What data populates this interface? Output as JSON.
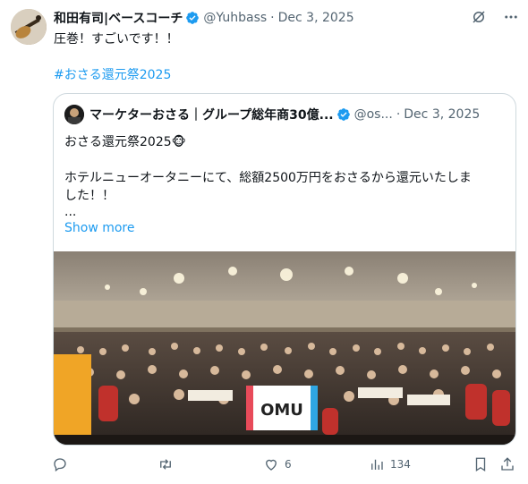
{
  "author": {
    "display_name": "和田有司|ベースコーチ",
    "handle": "@Yuhbass",
    "separator": "·",
    "date": "Dec 3, 2025"
  },
  "post": {
    "text": "圧巻！すごいです！！",
    "hashtag": "#おさる還元祭2025"
  },
  "quoted": {
    "display_name": "マーケターおさる｜グループ総年商30億...",
    "handle": "@os...",
    "separator": "·",
    "date": "Dec 3, 2025",
    "line1": "おさる還元祭2025🐵",
    "line2": "ホテルニューオータニーにて、総額2500万円をおさるから還元いたしま",
    "line3": "した！！",
    "line4": "...",
    "show_more": "Show more",
    "banner_text": "OMU"
  },
  "actions": {
    "likes": "6",
    "views": "134"
  },
  "icons": {
    "verified": "verified-badge-icon",
    "grok": "grok-icon",
    "more": "more-icon",
    "reply": "reply-icon",
    "repost": "repost-icon",
    "like": "heart-icon",
    "views": "views-icon",
    "bookmark": "bookmark-icon",
    "share": "share-icon"
  },
  "colors": {
    "link": "#1d9bf0",
    "muted": "#536471",
    "text": "#0f1419",
    "verified": "#1d9bf0"
  }
}
